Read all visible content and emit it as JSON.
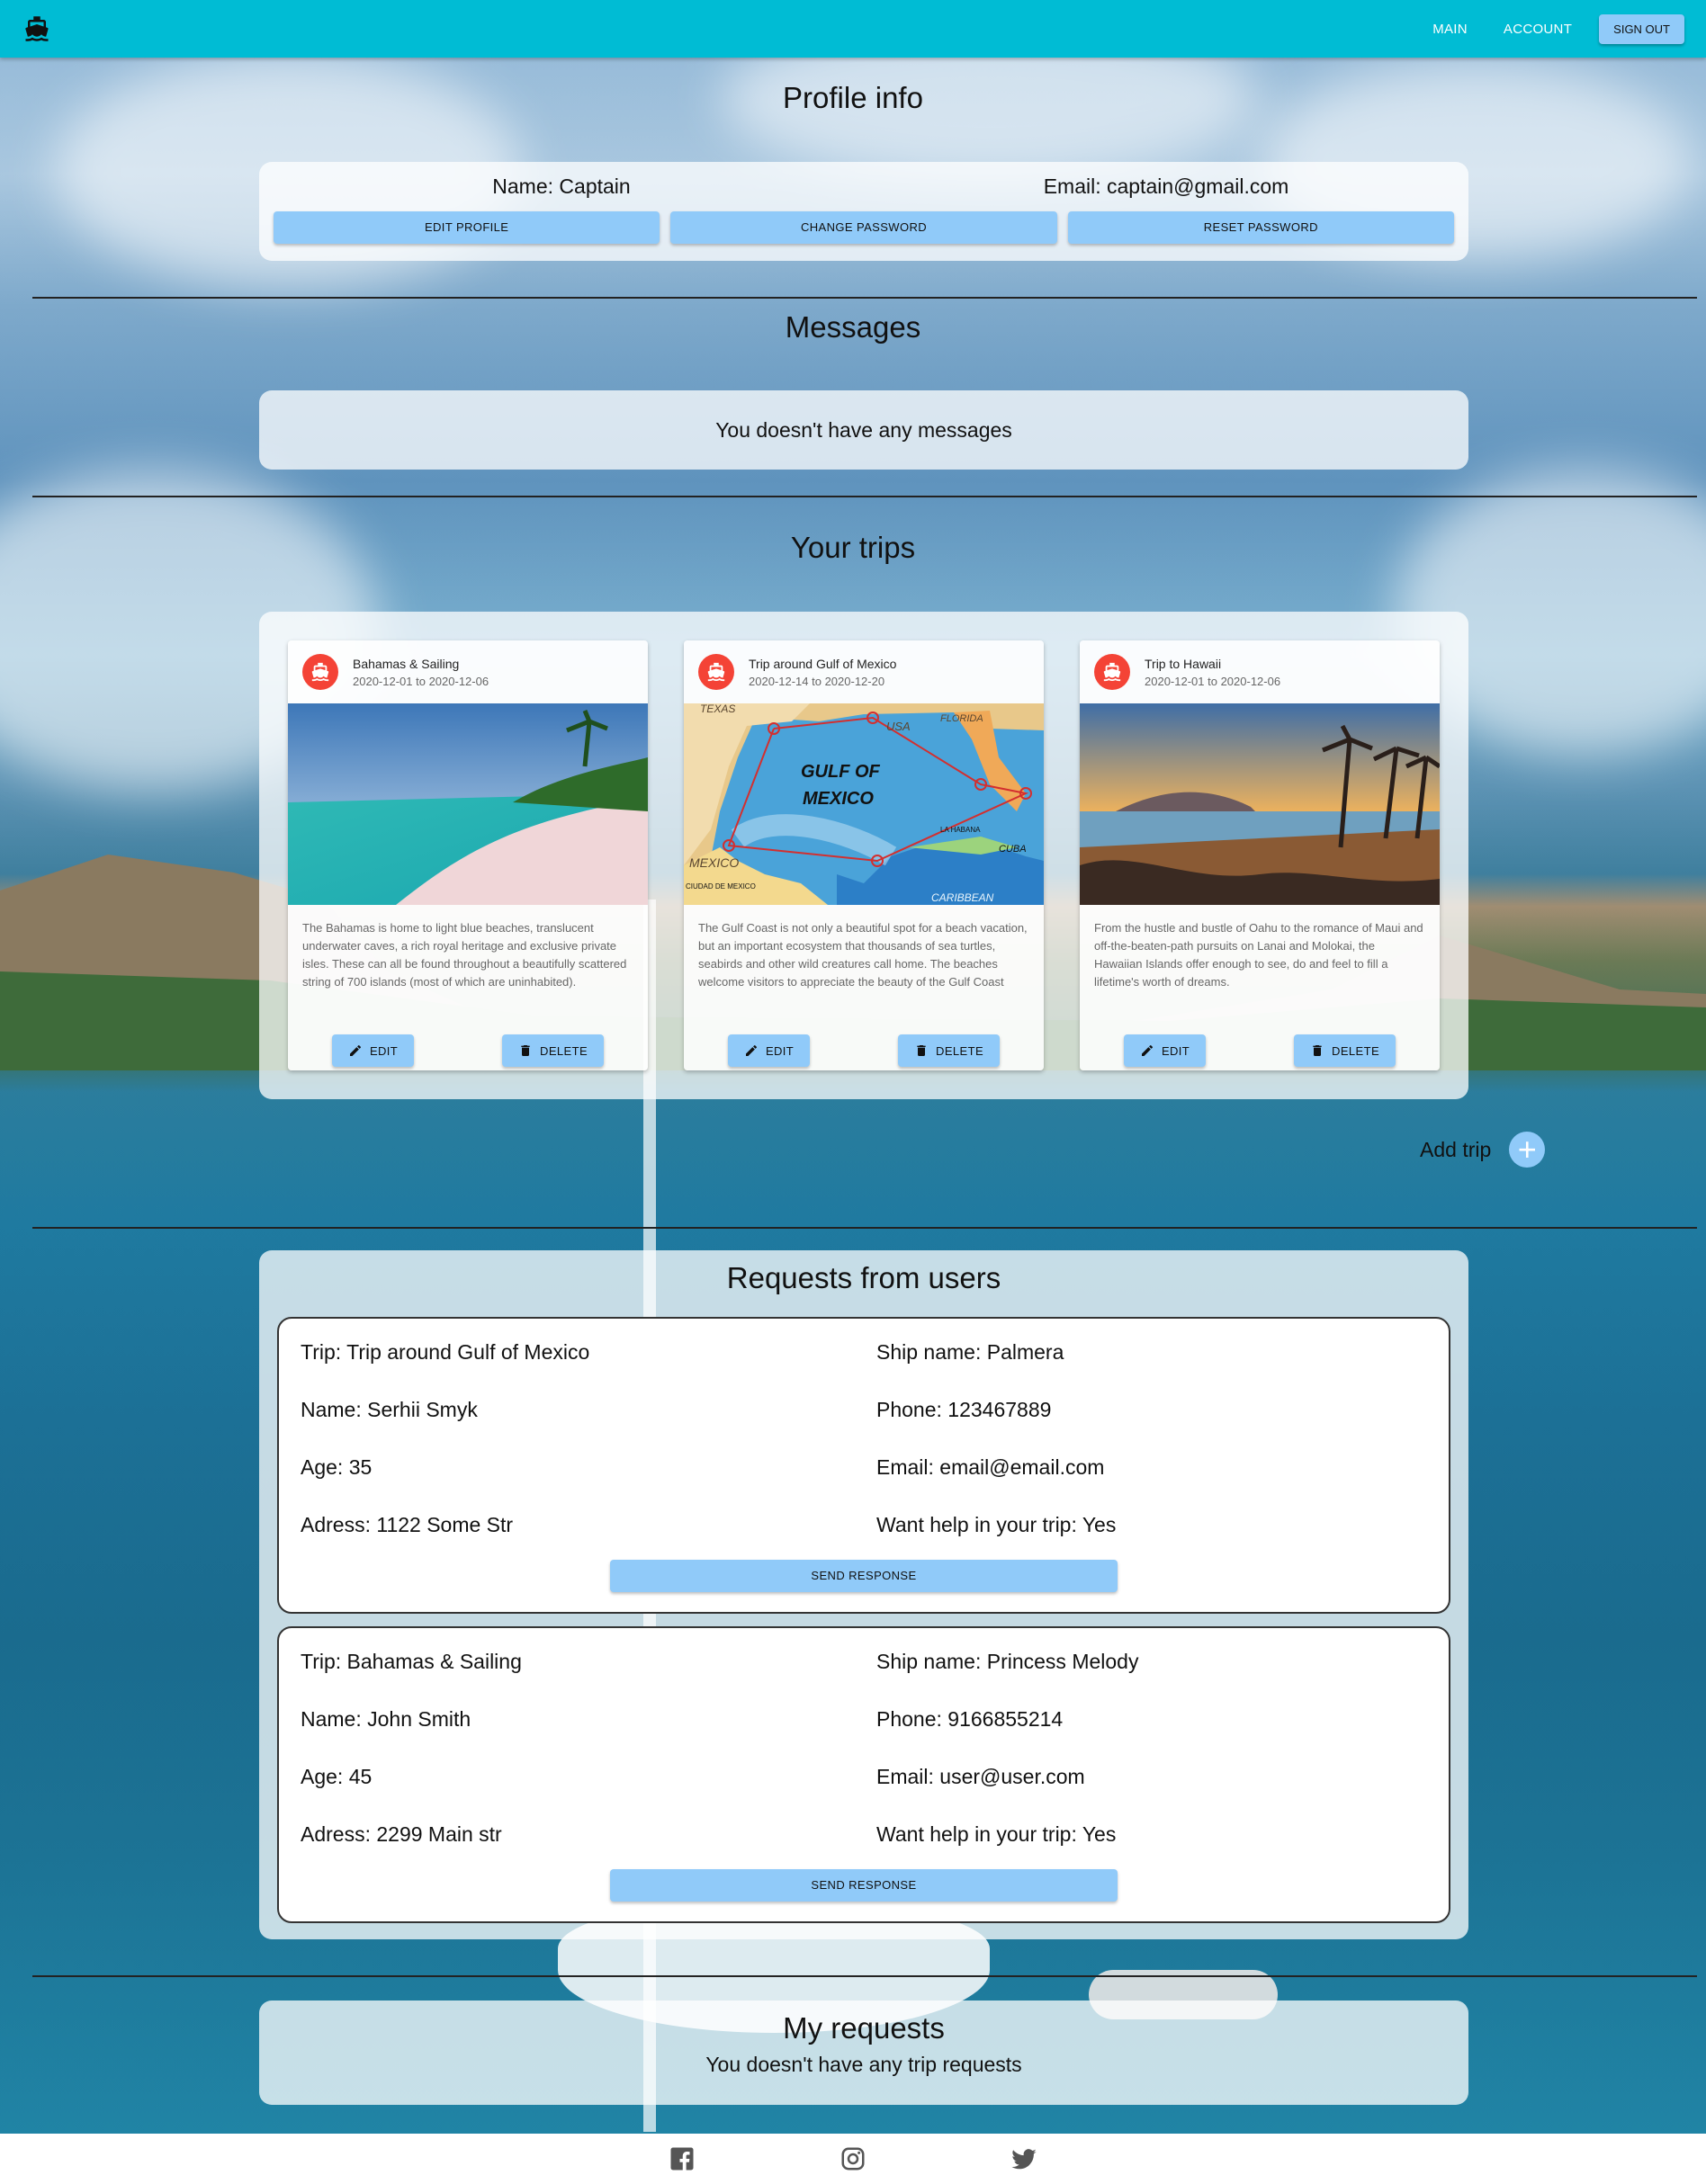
{
  "appbar": {
    "logo_icon": "ship-icon",
    "nav": [
      {
        "label": "MAIN"
      },
      {
        "label": "ACCOUNT"
      }
    ],
    "signout_label": "SIGN OUT"
  },
  "profile": {
    "title": "Profile info",
    "name": "Name: Captain",
    "email": "Email: captain@gmail.com",
    "buttons": [
      "EDIT PROFILE",
      "CHANGE PASSWORD",
      "RESET PASSWORD"
    ]
  },
  "messages": {
    "title": "Messages",
    "empty_text": "You doesn't have any messages"
  },
  "trips": {
    "title": "Your trips",
    "items": [
      {
        "title": "Bahamas & Sailing",
        "date": "2020-12-01 to 2020-12-06",
        "description": "The Bahamas is home to light blue beaches, translucent underwater caves, a rich royal heritage and exclusive private isles. These can all be found throughout a beautifully scattered string of 700 islands (most of which are uninhabited).",
        "edit_label": "EDIT",
        "delete_label": "DELETE"
      },
      {
        "title": "Trip around Gulf of Mexico",
        "date": "2020-12-14 to 2020-12-20",
        "description": "The Gulf Coast is not only a beautiful spot for a beach vacation, but an important ecosystem that thousands of sea turtles, seabirds and other wild creatures call home. The beaches welcome visitors to appreciate the beauty of the Gulf Coast",
        "edit_label": "EDIT",
        "delete_label": "DELETE",
        "map_labels": {
          "texas": "TEXAS",
          "usa": "USA",
          "florida": "FLORIDA",
          "gulf1": "GULF OF",
          "gulf2": "MEXICO",
          "mexico": "MEXICO",
          "cuba": "CUBA",
          "caribbean": "CARIBBEAN",
          "habana": "LA HABANA",
          "cdmx": "CIUDAD DE MEXICO"
        }
      },
      {
        "title": "Trip to Hawaii",
        "date": "2020-12-01 to 2020-12-06",
        "description": "From the hustle and bustle of Oahu to the romance of Maui and off-the-beaten-path pursuits on Lanai and Molokai, the Hawaiian Islands offer enough to see, do and feel to fill a lifetime's worth of dreams.",
        "edit_label": "EDIT",
        "delete_label": "DELETE"
      }
    ],
    "add_label": "Add trip",
    "add_symbol": "+"
  },
  "requests": {
    "title": "Requests from users",
    "items": [
      {
        "trip": "Trip: Trip around Gulf of Mexico",
        "ship": "Ship name: Palmera",
        "name": "Name: Serhii Smyk",
        "phone": "Phone: 123467889",
        "age": "Age: 35",
        "email": "Email: email@email.com",
        "address": "Adress: 1122 Some Str",
        "help": "Want help in your trip: Yes",
        "button": "SEND RESPONSE"
      },
      {
        "trip": "Trip: Bahamas & Sailing",
        "ship": "Ship name: Princess Melody",
        "name": "Name: John Smith",
        "phone": "Phone: 9166855214",
        "age": "Age: 45",
        "email": "Email: user@user.com",
        "address": "Adress: 2299 Main str",
        "help": "Want help in your trip: Yes",
        "button": "SEND RESPONSE"
      }
    ]
  },
  "my_requests": {
    "title": "My requests",
    "empty_text": "You doesn't have any trip requests"
  },
  "footer": {
    "icons": [
      "facebook-icon",
      "instagram-icon",
      "twitter-icon"
    ]
  },
  "colors": {
    "appbar": "#00bcd4",
    "button": "#90caf9",
    "avatar": "#f44336"
  }
}
